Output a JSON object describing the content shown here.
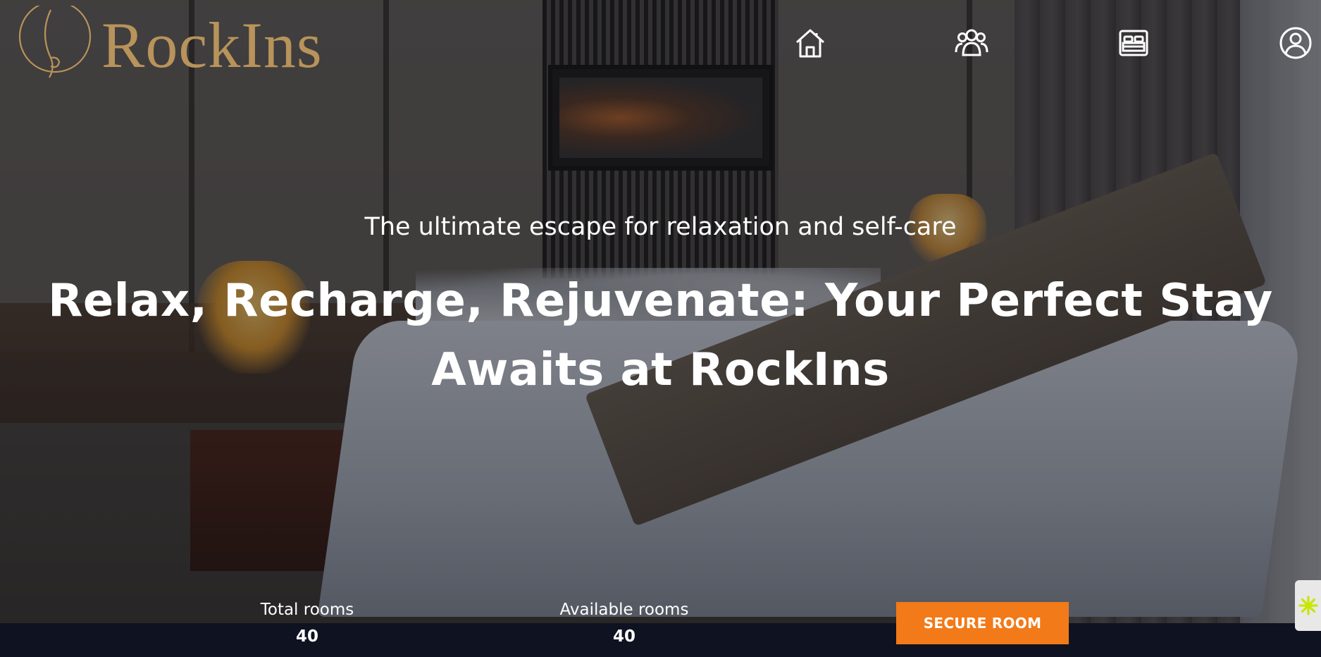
{
  "brand": {
    "name": "RockIns",
    "logo_color": "#b8935a",
    "mark_icon": "logo-mark-icon"
  },
  "nav": {
    "items": [
      {
        "name": "home",
        "icon": "home-icon"
      },
      {
        "name": "guests",
        "icon": "users-icon"
      },
      {
        "name": "rooms",
        "icon": "bed-icon"
      },
      {
        "name": "account",
        "icon": "user-circle-icon"
      }
    ]
  },
  "hero": {
    "tagline": "The ultimate escape for relaxation and self-care",
    "headline_line1": "Relax, Recharge, Rejuvenate: Your Perfect Stay",
    "headline_line2": "Awaits at RockIns"
  },
  "stats": {
    "total_rooms": {
      "label": "Total rooms",
      "value": "40"
    },
    "available_rooms": {
      "label": "Available rooms",
      "value": "40"
    }
  },
  "cta": {
    "label": "SECURE ROOM",
    "color": "#f27a18"
  },
  "widget": {
    "icon": "sparkle-icon",
    "color": "#c8e600"
  }
}
